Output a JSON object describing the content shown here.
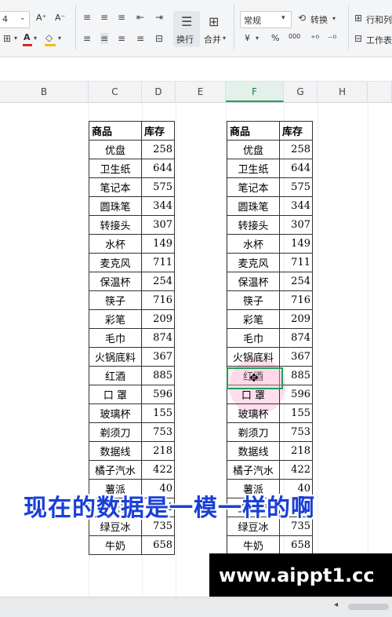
{
  "ribbon": {
    "font_size": "4",
    "increase_font": "A⁺",
    "decrease_font": "A⁻",
    "font_color_glyph": "A",
    "wrap_label": "换行",
    "merge_label": "合并",
    "number_format": "常规",
    "convert_label": "转换",
    "currency": "¥",
    "percent": "%",
    "thousands": "000",
    "row_col_label": "行和列",
    "worksheet_label": "工作表",
    "accent_color": "#22a05a",
    "font_color_underline": "#d9262c",
    "fill_color_underline": "#f2c100"
  },
  "columns": {
    "B": "B",
    "C": "C",
    "D": "D",
    "E": "E",
    "F": "F",
    "G": "G",
    "H": "H"
  },
  "table_left": {
    "header": {
      "name": "商品",
      "qty": "库存"
    },
    "rows": [
      {
        "name": "优盘",
        "qty": "258"
      },
      {
        "name": "卫生纸",
        "qty": "644"
      },
      {
        "name": "笔记本",
        "qty": "575"
      },
      {
        "name": "圆珠笔",
        "qty": "344"
      },
      {
        "name": "转接头",
        "qty": "307"
      },
      {
        "name": "水杯",
        "qty": "149"
      },
      {
        "name": "麦克风",
        "qty": "711"
      },
      {
        "name": "保温杯",
        "qty": "254"
      },
      {
        "name": "筷子",
        "qty": "716"
      },
      {
        "name": "彩笔",
        "qty": "209"
      },
      {
        "name": "毛巾",
        "qty": "874"
      },
      {
        "name": "火锅底料",
        "qty": "367"
      },
      {
        "name": "红酒",
        "qty": "885"
      },
      {
        "name": "口 罩",
        "qty": "596"
      },
      {
        "name": "玻璃杯",
        "qty": "155"
      },
      {
        "name": "剃须刀",
        "qty": "753"
      },
      {
        "name": "数据线",
        "qty": "218"
      },
      {
        "name": "橘子汽水",
        "qty": "422"
      },
      {
        "name": "薯派",
        "qty": "40"
      },
      {
        "name": "王老吉",
        "qty": "384"
      },
      {
        "name": "绿豆冰",
        "qty": "735"
      },
      {
        "name": "牛奶",
        "qty": "658"
      }
    ]
  },
  "table_right": {
    "header": {
      "name": "商品",
      "qty": "库存"
    },
    "rows": [
      {
        "name": "优盘",
        "qty": "258"
      },
      {
        "name": "卫生纸",
        "qty": "644"
      },
      {
        "name": "笔记本",
        "qty": "575"
      },
      {
        "name": "圆珠笔",
        "qty": "344"
      },
      {
        "name": "转接头",
        "qty": "307"
      },
      {
        "name": "水杯",
        "qty": "149"
      },
      {
        "name": "麦克风",
        "qty": "711"
      },
      {
        "name": "保温杯",
        "qty": "254"
      },
      {
        "name": "筷子",
        "qty": "716"
      },
      {
        "name": "彩笔",
        "qty": "209"
      },
      {
        "name": "毛巾",
        "qty": "874"
      },
      {
        "name": "火锅底料",
        "qty": "367"
      },
      {
        "name": "红酒",
        "qty": "885"
      },
      {
        "name": "口 罩",
        "qty": "596"
      },
      {
        "name": "玻璃杯",
        "qty": "155"
      },
      {
        "name": "剃须刀",
        "qty": "753"
      },
      {
        "name": "数据线",
        "qty": "218"
      },
      {
        "name": "橘子汽水",
        "qty": "422"
      },
      {
        "name": "薯派",
        "qty": "40"
      },
      {
        "name": "王老吉",
        "qty": "384"
      },
      {
        "name": "绿豆冰",
        "qty": "735"
      },
      {
        "name": "牛奶",
        "qty": "658"
      }
    ]
  },
  "subtitle": "现在的数据是一模一样的啊",
  "watermark": "www.aippt1.cc"
}
